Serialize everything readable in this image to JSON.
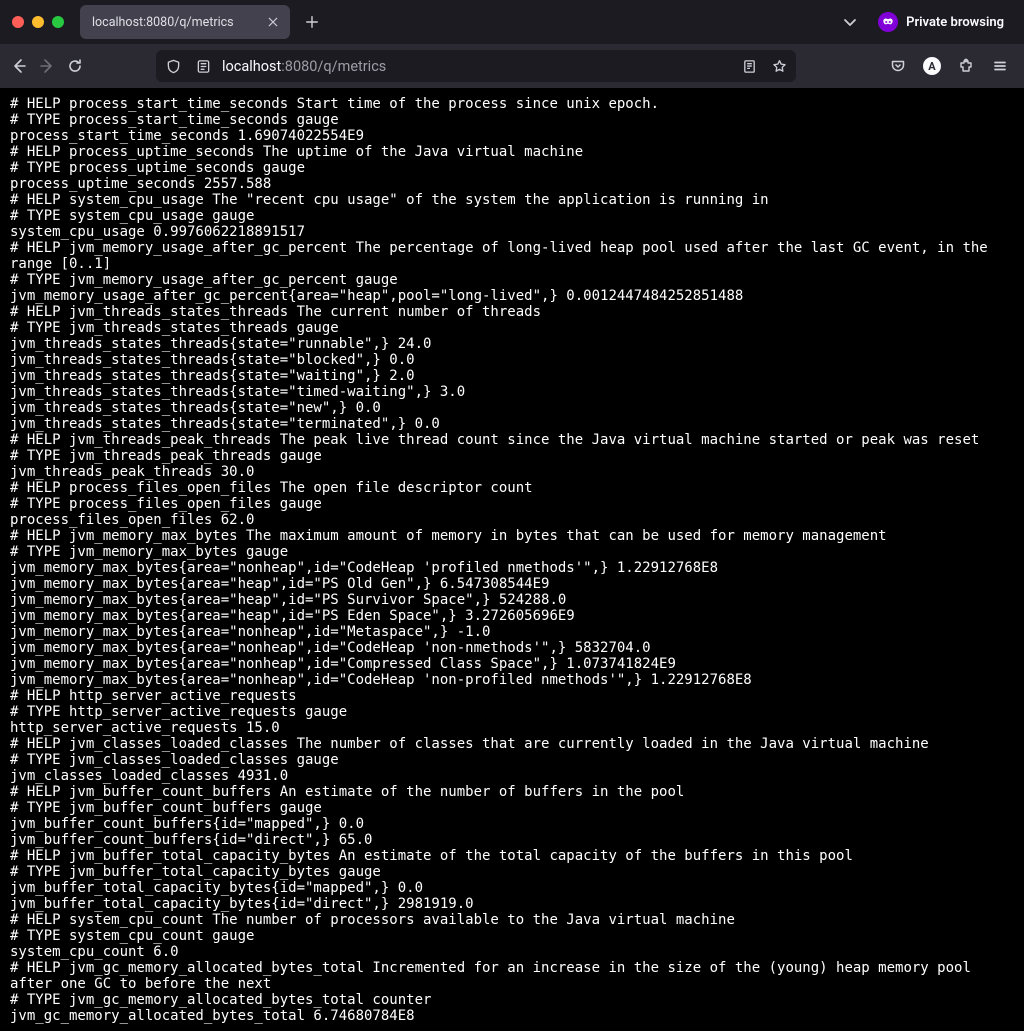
{
  "tab": {
    "title": "localhost:8080/q/metrics"
  },
  "private_label": "Private browsing",
  "url": {
    "host": "localhost",
    "path": ":8080/q/metrics"
  },
  "account_letter": "A",
  "metrics_lines": [
    "# HELP process_start_time_seconds Start time of the process since unix epoch.",
    "# TYPE process_start_time_seconds gauge",
    "process_start_time_seconds 1.69074022554E9",
    "# HELP process_uptime_seconds The uptime of the Java virtual machine",
    "# TYPE process_uptime_seconds gauge",
    "process_uptime_seconds 2557.588",
    "# HELP system_cpu_usage The \"recent cpu usage\" of the system the application is running in",
    "# TYPE system_cpu_usage gauge",
    "system_cpu_usage 0.9976062218891517",
    "# HELP jvm_memory_usage_after_gc_percent The percentage of long-lived heap pool used after the last GC event, in the range [0..1]",
    "# TYPE jvm_memory_usage_after_gc_percent gauge",
    "jvm_memory_usage_after_gc_percent{area=\"heap\",pool=\"long-lived\",} 0.0012447484252851488",
    "# HELP jvm_threads_states_threads The current number of threads",
    "# TYPE jvm_threads_states_threads gauge",
    "jvm_threads_states_threads{state=\"runnable\",} 24.0",
    "jvm_threads_states_threads{state=\"blocked\",} 0.0",
    "jvm_threads_states_threads{state=\"waiting\",} 2.0",
    "jvm_threads_states_threads{state=\"timed-waiting\",} 3.0",
    "jvm_threads_states_threads{state=\"new\",} 0.0",
    "jvm_threads_states_threads{state=\"terminated\",} 0.0",
    "# HELP jvm_threads_peak_threads The peak live thread count since the Java virtual machine started or peak was reset",
    "# TYPE jvm_threads_peak_threads gauge",
    "jvm_threads_peak_threads 30.0",
    "# HELP process_files_open_files The open file descriptor count",
    "# TYPE process_files_open_files gauge",
    "process_files_open_files 62.0",
    "# HELP jvm_memory_max_bytes The maximum amount of memory in bytes that can be used for memory management",
    "# TYPE jvm_memory_max_bytes gauge",
    "jvm_memory_max_bytes{area=\"nonheap\",id=\"CodeHeap 'profiled nmethods'\",} 1.22912768E8",
    "jvm_memory_max_bytes{area=\"heap\",id=\"PS Old Gen\",} 6.547308544E9",
    "jvm_memory_max_bytes{area=\"heap\",id=\"PS Survivor Space\",} 524288.0",
    "jvm_memory_max_bytes{area=\"heap\",id=\"PS Eden Space\",} 3.272605696E9",
    "jvm_memory_max_bytes{area=\"nonheap\",id=\"Metaspace\",} -1.0",
    "jvm_memory_max_bytes{area=\"nonheap\",id=\"CodeHeap 'non-nmethods'\",} 5832704.0",
    "jvm_memory_max_bytes{area=\"nonheap\",id=\"Compressed Class Space\",} 1.073741824E9",
    "jvm_memory_max_bytes{area=\"nonheap\",id=\"CodeHeap 'non-profiled nmethods'\",} 1.22912768E8",
    "# HELP http_server_active_requests",
    "# TYPE http_server_active_requests gauge",
    "http_server_active_requests 15.0",
    "# HELP jvm_classes_loaded_classes The number of classes that are currently loaded in the Java virtual machine",
    "# TYPE jvm_classes_loaded_classes gauge",
    "jvm_classes_loaded_classes 4931.0",
    "# HELP jvm_buffer_count_buffers An estimate of the number of buffers in the pool",
    "# TYPE jvm_buffer_count_buffers gauge",
    "jvm_buffer_count_buffers{id=\"mapped\",} 0.0",
    "jvm_buffer_count_buffers{id=\"direct\",} 65.0",
    "# HELP jvm_buffer_total_capacity_bytes An estimate of the total capacity of the buffers in this pool",
    "# TYPE jvm_buffer_total_capacity_bytes gauge",
    "jvm_buffer_total_capacity_bytes{id=\"mapped\",} 0.0",
    "jvm_buffer_total_capacity_bytes{id=\"direct\",} 2981919.0",
    "# HELP system_cpu_count The number of processors available to the Java virtual machine",
    "# TYPE system_cpu_count gauge",
    "system_cpu_count 6.0",
    "# HELP jvm_gc_memory_allocated_bytes_total Incremented for an increase in the size of the (young) heap memory pool after one GC to before the next",
    "# TYPE jvm_gc_memory_allocated_bytes_total counter",
    "jvm_gc_memory_allocated_bytes_total 6.74680784E8"
  ]
}
